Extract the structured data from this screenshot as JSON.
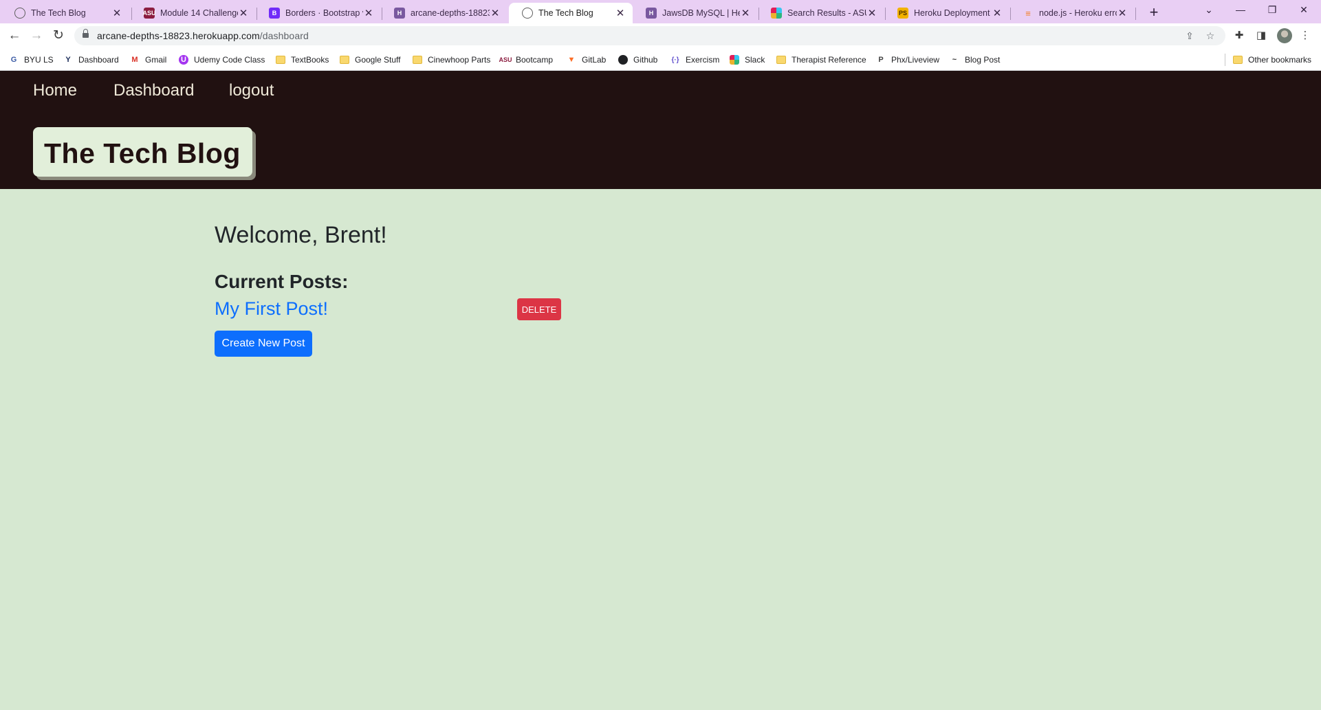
{
  "browser": {
    "tabs": [
      {
        "title": "The Tech Blog",
        "icon": "globe-icon",
        "active": false
      },
      {
        "title": "Module 14 Challenge",
        "icon": "asu-icon",
        "active": false
      },
      {
        "title": "Borders · Bootstrap v5",
        "icon": "bootstrap-icon",
        "active": false
      },
      {
        "title": "arcane-depths-18823",
        "icon": "heroku-icon",
        "active": false
      },
      {
        "title": "The Tech Blog",
        "icon": "globe-icon",
        "active": true
      },
      {
        "title": "JawsDB MySQL | Hero",
        "icon": "heroku-icon",
        "active": false
      },
      {
        "title": "Search Results - ASU-",
        "icon": "slack-icon",
        "active": false
      },
      {
        "title": "Heroku Deployment G",
        "icon": "pluralsight-icon",
        "active": false
      },
      {
        "title": "node.js - Heroku error",
        "icon": "stackoverflow-icon",
        "active": false
      }
    ],
    "address": {
      "host": "arcane-depths-18823.herokuapp.com",
      "path": "/dashboard"
    },
    "bookmarks": [
      {
        "label": "BYU LS",
        "icon": "byu-icon"
      },
      {
        "label": "Dashboard",
        "icon": "y-icon"
      },
      {
        "label": "Gmail",
        "icon": "gmail-icon"
      },
      {
        "label": "Udemy Code Class",
        "icon": "udemy-icon"
      },
      {
        "label": "TextBooks",
        "icon": "folder-icon"
      },
      {
        "label": "Google Stuff",
        "icon": "folder-icon"
      },
      {
        "label": "Cinewhoop Parts",
        "icon": "folder-icon"
      },
      {
        "label": "Bootcamp",
        "icon": "asu-icon"
      },
      {
        "label": "GitLab",
        "icon": "gitlab-icon"
      },
      {
        "label": "Github",
        "icon": "github-icon"
      },
      {
        "label": "Exercism",
        "icon": "exercism-icon"
      },
      {
        "label": "Slack",
        "icon": "slack-icon"
      },
      {
        "label": "Therapist Reference",
        "icon": "folder-icon"
      },
      {
        "label": "Phx/Liveview",
        "icon": "phx-icon"
      },
      {
        "label": "Blog Post",
        "icon": "blog-icon"
      }
    ],
    "other_bookmarks": "Other bookmarks"
  },
  "site": {
    "nav": {
      "home": "Home",
      "dashboard": "Dashboard",
      "logout": "logout"
    },
    "brand": "The Tech Blog"
  },
  "dashboard": {
    "welcome": "Welcome, Brent!",
    "current_posts_heading": "Current Posts:",
    "posts": [
      {
        "title": "My First Post!",
        "delete_label": "DELETE"
      }
    ],
    "create_label": "Create New Post"
  },
  "colors": {
    "header_bg": "#211111",
    "page_bg": "#d6e8d1",
    "brand_bg": "#e2efda",
    "link": "#0d6efd",
    "danger": "#dc3545",
    "primary": "#0d6efd"
  }
}
